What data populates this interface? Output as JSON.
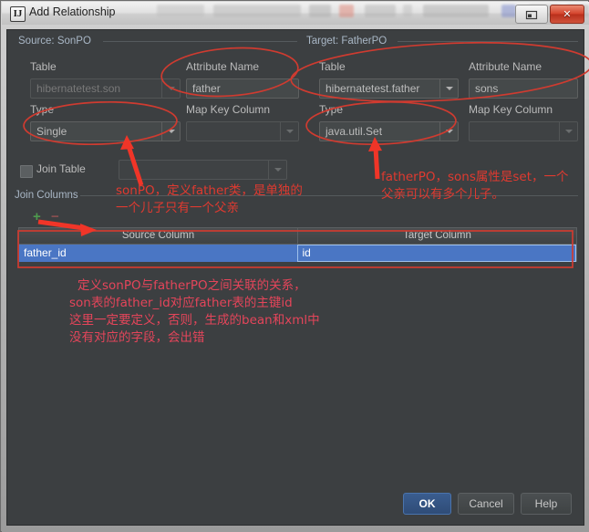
{
  "window": {
    "title": "Add Relationship",
    "app_icon": "IJ",
    "restore_icon": "restore-icon",
    "close_icon": "✕"
  },
  "source_group": {
    "title": "Source: SonPO",
    "table_label": "Table",
    "table_value": "hibernatetest.son",
    "attribute_label": "Attribute Name",
    "attribute_value": "father",
    "type_label": "Type",
    "type_value": "Single",
    "mapkey_label": "Map Key Column",
    "mapkey_value": ""
  },
  "target_group": {
    "title": "Target: FatherPO",
    "table_label": "Table",
    "table_value": "hibernatetest.father",
    "attribute_label": "Attribute Name",
    "attribute_value": "sons",
    "type_label": "Type",
    "type_value": "java.util.Set",
    "mapkey_label": "Map Key Column",
    "mapkey_value": ""
  },
  "join": {
    "join_table_label": "Join Table",
    "join_table_value": "",
    "join_columns_label": "Join Columns",
    "add_label": "+",
    "remove_label": "−",
    "columns": [
      "Source Column",
      "Target Column"
    ],
    "rows": [
      {
        "source": "father_id",
        "target": "id"
      }
    ]
  },
  "buttons": {
    "ok": "OK",
    "cancel": "Cancel",
    "help": "Help"
  },
  "annotations": {
    "left_line1": "sonPO，定义father类，是单独的",
    "left_line2": "一个儿子只有一个父亲",
    "right_line1": "fatherPO，sons属性是set，一个",
    "right_line2": "父亲可以有多个儿子。",
    "bottom_line1": "定义sonPO与fatherPO之间关联的关系，",
    "bottom_line2": "son表的father_id对应father表的主键id",
    "bottom_line3": "这里一定要定义，否则，生成的bean和xml中",
    "bottom_line4": "没有对应的字段，会出错"
  },
  "colors": {
    "annotation_red": "#e03a30",
    "annotation_pink": "#e4455a",
    "selection_blue": "#4a76c4",
    "dialog_bg": "#3c3f41",
    "close_red": "#d4432c"
  }
}
